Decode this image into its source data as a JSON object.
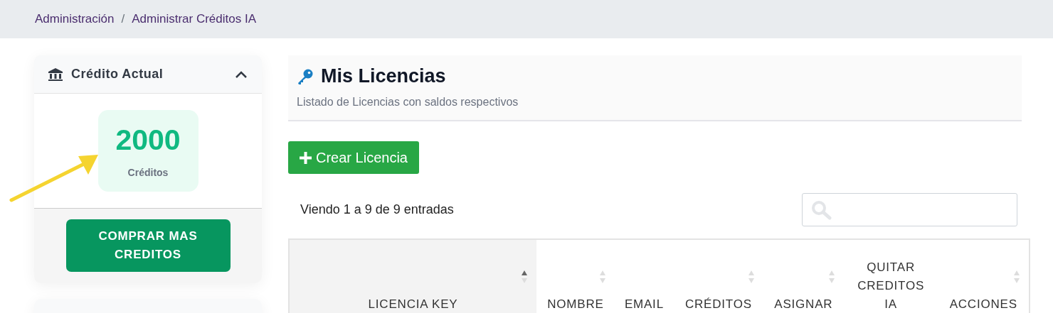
{
  "breadcrumb": {
    "separator": "/",
    "items": [
      {
        "label": "Administración"
      },
      {
        "label": "Administrar Créditos IA"
      }
    ]
  },
  "credit_card": {
    "title": "Crédito Actual",
    "expanded": true,
    "amount": "2000",
    "unit": "Créditos",
    "button": "COMPRAR MAS CREDITOS"
  },
  "second_card": {
    "kind": "collapsed-peek"
  },
  "licenses": {
    "title": "Mis Licencias",
    "subtitle": "Listado de Licencias con saldos respectivos",
    "create_button": "Crear Licencia",
    "info": "Viendo 1 a 9 de 9 entradas",
    "table": {
      "columns": [
        {
          "label": "LICENCIA KEY",
          "sortable": true,
          "sorted": true
        },
        {
          "label": "NOMBRE",
          "sortable": true,
          "sorted": false
        },
        {
          "label": "EMAIL",
          "sortable": false
        },
        {
          "label": "CRÉDITOS",
          "sortable": true,
          "sorted": false
        },
        {
          "label": "ASIGNAR",
          "sortable": true,
          "sorted": false
        },
        {
          "label": "QUITAR CREDITOS IA",
          "sortable": false
        },
        {
          "label": "ACCIONES",
          "sortable": true,
          "sorted": false
        }
      ]
    }
  }
}
